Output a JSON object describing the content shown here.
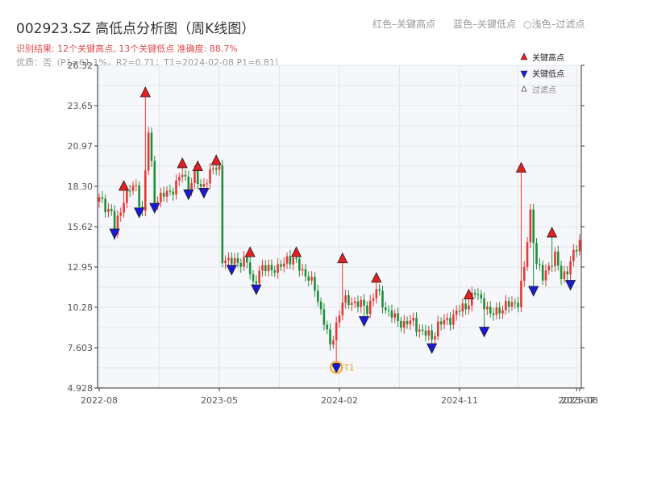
{
  "header": {
    "title": "002923.SZ 高低点分析图（周K线图）",
    "subtitle": "识别结果: 12个关键高点, 13个关键低点  准确度: 88.7%",
    "subtitle2": "优质：否（P1=61.1%，R2=0.71；T1=2024-02-08 P1=6.81）"
  },
  "top_legend": {
    "red_text": "红色–关键高点",
    "blue_text": "蓝色–关键低点",
    "light_text": "○浅色–过滤点"
  },
  "colors": {
    "up": "#e53935",
    "down": "#1f8f3a",
    "high_marker": "#e32020",
    "low_marker": "#1a1ad6",
    "t1_ring": "#f5a623",
    "plot_bg": "#f5f7fa",
    "grid": "#e1e5ea"
  },
  "chart_data": {
    "type": "candlestick",
    "title": "002923.SZ 高低点分析图（周K线图）",
    "y_ticks": [
      "26.32",
      "23.65",
      "20.97",
      "18.30",
      "15.62",
      "12.95",
      "10.28",
      "7.603",
      "4.928"
    ],
    "ylim": [
      4.928,
      26.32
    ],
    "x_ticks": [
      "2022-08",
      "2023-05",
      "2024-02",
      "2024-11",
      "2025-07",
      "2025-08"
    ],
    "x_tick_positions": [
      0,
      39,
      78,
      117,
      155,
      156
    ],
    "grid": true,
    "legend": {
      "placement": "top-right",
      "entries": [
        "关键高点",
        "关键低点",
        "过滤点"
      ]
    },
    "n_bars": 157,
    "anchors": [
      [
        0,
        17.4
      ],
      [
        4,
        16.6
      ],
      [
        5,
        15.2
      ],
      [
        8,
        17.5
      ],
      [
        10,
        18.1
      ],
      [
        12,
        18.2
      ],
      [
        14,
        16.6
      ],
      [
        16,
        21.9
      ],
      [
        18,
        17.4
      ],
      [
        20,
        17.6
      ],
      [
        23,
        17.9
      ],
      [
        25,
        18.5
      ],
      [
        27,
        19.1
      ],
      [
        29,
        18.3
      ],
      [
        31,
        19.0
      ],
      [
        33,
        18.1
      ],
      [
        35,
        18.9
      ],
      [
        37,
        19.4
      ],
      [
        39,
        19.5
      ],
      [
        40,
        13.6
      ],
      [
        42,
        13.2
      ],
      [
        44,
        13.4
      ],
      [
        46,
        13.3
      ],
      [
        48,
        13.2
      ],
      [
        50,
        11.9
      ],
      [
        52,
        12.6
      ],
      [
        55,
        13.0
      ],
      [
        58,
        12.7
      ],
      [
        61,
        13.6
      ],
      [
        64,
        13.2
      ],
      [
        67,
        12.5
      ],
      [
        70,
        11.5
      ],
      [
        73,
        9.4
      ],
      [
        75,
        7.6
      ],
      [
        77,
        9.2
      ],
      [
        79,
        10.6
      ],
      [
        82,
        10.7
      ],
      [
        85,
        10.4
      ],
      [
        87,
        10.2
      ],
      [
        90,
        11.4
      ],
      [
        93,
        10.2
      ],
      [
        96,
        9.5
      ],
      [
        99,
        9.2
      ],
      [
        102,
        9.3
      ],
      [
        105,
        8.6
      ],
      [
        108,
        8.3
      ],
      [
        110,
        9.1
      ],
      [
        113,
        9.4
      ],
      [
        116,
        9.9
      ],
      [
        119,
        10.4
      ],
      [
        122,
        11.2
      ],
      [
        125,
        10.6
      ],
      [
        127,
        9.7
      ],
      [
        130,
        10.2
      ],
      [
        133,
        10.4
      ],
      [
        136,
        10.7
      ],
      [
        138,
        12.8
      ],
      [
        140,
        16.6
      ],
      [
        142,
        13.2
      ],
      [
        144,
        12.2
      ],
      [
        146,
        13.1
      ],
      [
        148,
        13.6
      ],
      [
        150,
        12.3
      ],
      [
        152,
        12.8
      ],
      [
        154,
        13.7
      ],
      [
        156,
        14.7
      ]
    ],
    "key_highs": [
      {
        "x": 8,
        "y": 18.3
      },
      {
        "x": 15,
        "y": 24.5
      },
      {
        "x": 27,
        "y": 19.8
      },
      {
        "x": 32,
        "y": 19.6
      },
      {
        "x": 38,
        "y": 20.0
      },
      {
        "x": 49,
        "y": 13.9
      },
      {
        "x": 64,
        "y": 13.9
      },
      {
        "x": 79,
        "y": 13.5
      },
      {
        "x": 90,
        "y": 12.2
      },
      {
        "x": 120,
        "y": 11.1
      },
      {
        "x": 137,
        "y": 19.5
      },
      {
        "x": 147,
        "y": 15.2
      }
    ],
    "key_lows": [
      {
        "x": 5,
        "y": 15.2
      },
      {
        "x": 13,
        "y": 16.6
      },
      {
        "x": 18,
        "y": 16.9
      },
      {
        "x": 29,
        "y": 17.8
      },
      {
        "x": 34,
        "y": 17.9
      },
      {
        "x": 43,
        "y": 12.8
      },
      {
        "x": 51,
        "y": 11.5
      },
      {
        "x": 77,
        "y": 6.3
      },
      {
        "x": 86,
        "y": 9.4
      },
      {
        "x": 108,
        "y": 7.6
      },
      {
        "x": 125,
        "y": 8.7
      },
      {
        "x": 141,
        "y": 11.4
      },
      {
        "x": 153,
        "y": 11.8
      }
    ],
    "t1_point": {
      "x": 77,
      "y": 6.81,
      "label": "T1"
    }
  }
}
